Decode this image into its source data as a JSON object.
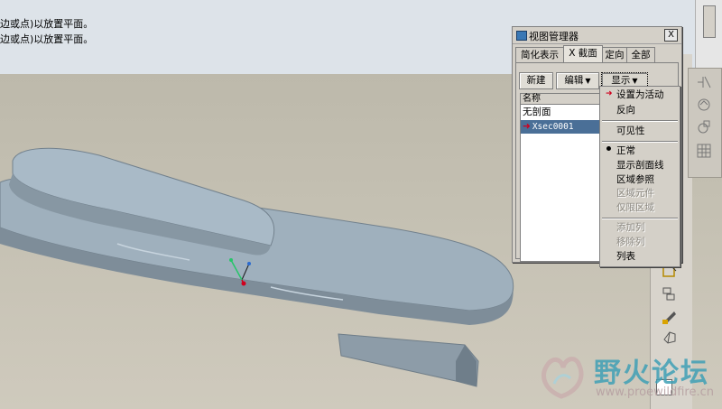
{
  "messages": {
    "line1": "边或点)以放置平面。",
    "line2": "边或点)以放置平面。"
  },
  "dialog": {
    "title": "视图管理器",
    "close_label": "X",
    "tabs": [
      "简化表示",
      "X 截面",
      "定向",
      "全部"
    ],
    "active_tab": "X 截面",
    "buttons": {
      "new": "新建",
      "edit": "编辑",
      "show": "显示"
    },
    "list": {
      "header": "名称",
      "items": [
        "无剖面",
        "Xsec0001"
      ]
    }
  },
  "menu": {
    "items": [
      {
        "label": "设置为活动",
        "enabled": true
      },
      {
        "label": "反向",
        "enabled": true
      },
      {
        "label": "可见性",
        "enabled": true
      },
      {
        "label": "正常",
        "enabled": true,
        "checked": true
      },
      {
        "label": "显示剖面线",
        "enabled": true
      },
      {
        "label": "区域参照",
        "enabled": true
      },
      {
        "label": "区域元件",
        "enabled": false
      },
      {
        "label": "仅限区域",
        "enabled": false
      },
      {
        "label": "添加列",
        "enabled": false
      },
      {
        "label": "移除列",
        "enabled": false
      },
      {
        "label": "列表",
        "enabled": true
      }
    ]
  },
  "watermark": {
    "title": "野火论坛",
    "url": "www.proewildfire.cn"
  },
  "colors": {
    "model": "#9aa9b6",
    "selection": "#4a6f97",
    "accent_red": "#d0001e"
  }
}
